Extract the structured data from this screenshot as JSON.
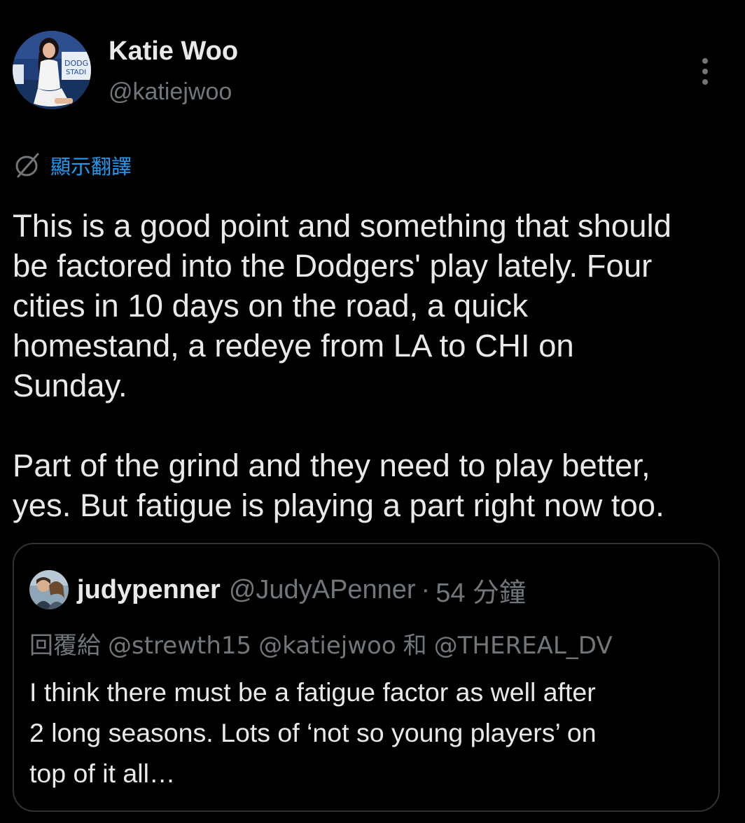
{
  "author": {
    "name": "Katie Woo",
    "handle": "@katiejwoo",
    "avatar_icon": "profile-photo"
  },
  "translate": {
    "label": "顯示翻譯",
    "icon": "globe-translate-icon",
    "color": "#1d9bf0"
  },
  "tweet": {
    "text": "This is a good point and something that should\nbe factored into the Dodgers' play lately. Four\ncities in 10 days on the road, a quick\nhomestand, a redeye from LA to CHI on\nSunday.\n\nPart of the grind and they need to play better,\nyes. But fatigue is playing a part right now too."
  },
  "quoted_tweet": {
    "name": "judypenner",
    "handle": "@JudyAPenner",
    "separator": "·",
    "time": "54 分鐘",
    "replying_prefix": "回覆給",
    "reply_to_1": "@strewth15",
    "reply_to_2": "@katiejwoo",
    "reply_conjunction": "和",
    "reply_to_3": "@THEREAL_DV",
    "text": "I think there must be a fatigue factor as well after\n2 long seasons. Lots of ‘not so young players’ on\ntop of it all…"
  },
  "colors": {
    "background": "#000000",
    "primary_text": "#e7e9ea",
    "secondary_text": "#71767b",
    "border": "#2f3336",
    "accent": "#1d9bf0"
  }
}
